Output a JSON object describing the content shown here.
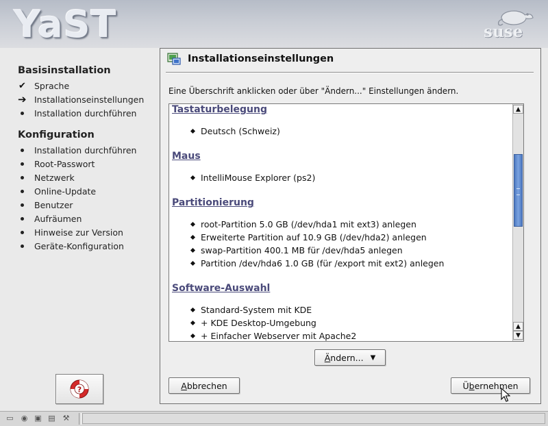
{
  "header": {
    "logo_text": "YaST",
    "brand_text": "suse"
  },
  "sidebar": {
    "section1": {
      "title": "Basisinstallation",
      "items": [
        {
          "label": "Sprache",
          "status": "done"
        },
        {
          "label": "Installationseinstellungen",
          "status": "current"
        },
        {
          "label": "Installation durchführen",
          "status": "pending"
        }
      ]
    },
    "section2": {
      "title": "Konfiguration",
      "items": [
        {
          "label": "Installation durchführen"
        },
        {
          "label": "Root-Passwort"
        },
        {
          "label": "Netzwerk"
        },
        {
          "label": "Online-Update"
        },
        {
          "label": "Benutzer"
        },
        {
          "label": "Aufräumen"
        },
        {
          "label": "Hinweise zur Version"
        },
        {
          "label": "Geräte-Konfiguration"
        }
      ]
    },
    "help_icon": "lifebuoy-help-icon"
  },
  "main": {
    "title": "Installationseinstellungen",
    "instruction": "Eine Überschrift anklicken oder über \"Ändern...\" Einstellungen ändern.",
    "sections": [
      {
        "title": "Tastaturbelegung",
        "items": [
          "Deutsch (Schweiz)"
        ]
      },
      {
        "title": "Maus",
        "items": [
          "IntelliMouse Explorer (ps2)"
        ]
      },
      {
        "title": "Partitionierung",
        "items": [
          "root-Partition 5.0 GB (/dev/hda1 mit ext3) anlegen",
          "Erweiterte Partition auf 10.9 GB (/dev/hda2) anlegen",
          "swap-Partition 400.1 MB für /dev/hda5 anlegen",
          "Partition /dev/hda6 1.0 GB (für /export mit ext2) anlegen"
        ]
      },
      {
        "title": "Software-Auswahl",
        "items": [
          "Standard-System mit KDE",
          "+ KDE Desktop-Umgebung",
          "+ Einfacher Webserver mit Apache2"
        ]
      }
    ],
    "scroll_position": 0.22,
    "buttons": {
      "change_accel": "Ä",
      "change_rest": "ndern...",
      "cancel_accel": "A",
      "cancel_rest": "bbrechen",
      "accept_pre": "Ü",
      "accept_accel": "b",
      "accept_rest": "ernehmen"
    }
  }
}
